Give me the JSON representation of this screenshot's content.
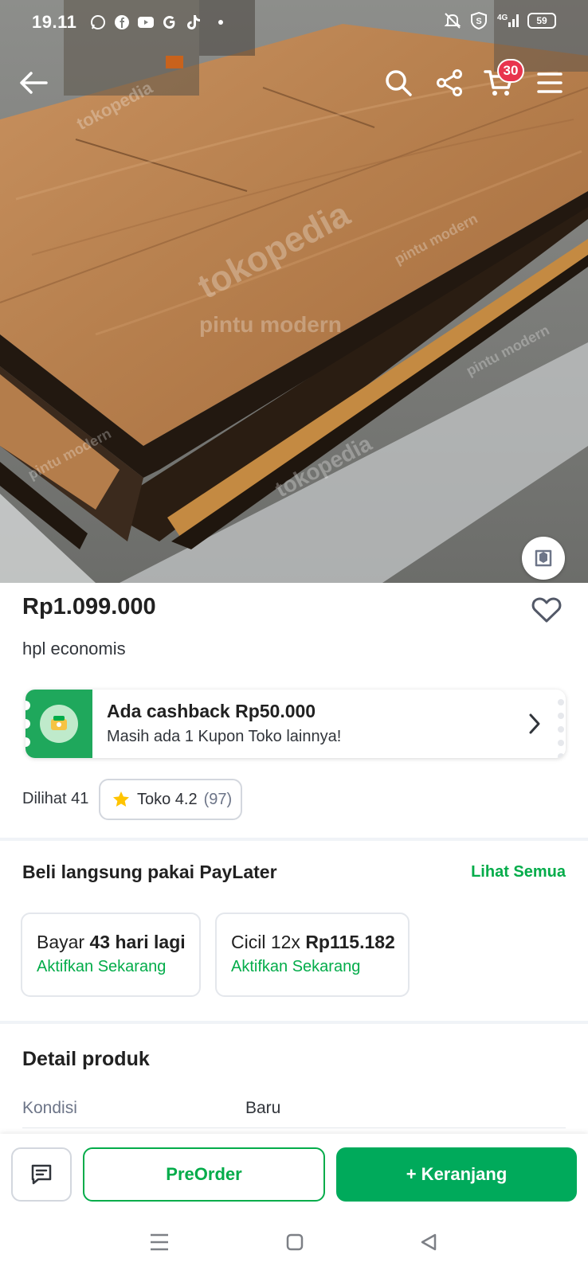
{
  "status_bar": {
    "time": "19.11",
    "apps": [
      "whatsapp-icon",
      "facebook-icon",
      "youtube-icon",
      "google-icon",
      "tiktok-icon"
    ],
    "network": "4G",
    "battery": "59"
  },
  "top_nav": {
    "cart_count": "30"
  },
  "hero": {
    "watermarks": [
      "tokopedia",
      "pintu modern"
    ]
  },
  "product": {
    "price": "Rp1.099.000",
    "name": "hpl economis"
  },
  "promo": {
    "title": "Ada cashback Rp50.000",
    "subtitle": "Masih ada 1 Kupon Toko lainnya!"
  },
  "stats": {
    "viewed": "Dilihat 41",
    "rating_label": "Toko 4.2",
    "rating_count": "(97)"
  },
  "paylater": {
    "title": "Beli langsung pakai PayLater",
    "see_all": "Lihat Semua",
    "cards": [
      {
        "prefix": "Bayar ",
        "highlight": "43 hari lagi",
        "action": "Aktifkan Sekarang"
      },
      {
        "prefix": "Cicil 12x ",
        "highlight": "Rp115.182",
        "action": "Aktifkan Sekarang"
      }
    ]
  },
  "details": {
    "title": "Detail produk",
    "rows": [
      {
        "label": "Kondisi",
        "value": "Baru"
      }
    ]
  },
  "actions": {
    "preorder": "PreOrder",
    "add_to_cart": "+ Keranjang"
  },
  "colors": {
    "brand_green": "#03ac4a",
    "badge_red": "#e8344d"
  }
}
